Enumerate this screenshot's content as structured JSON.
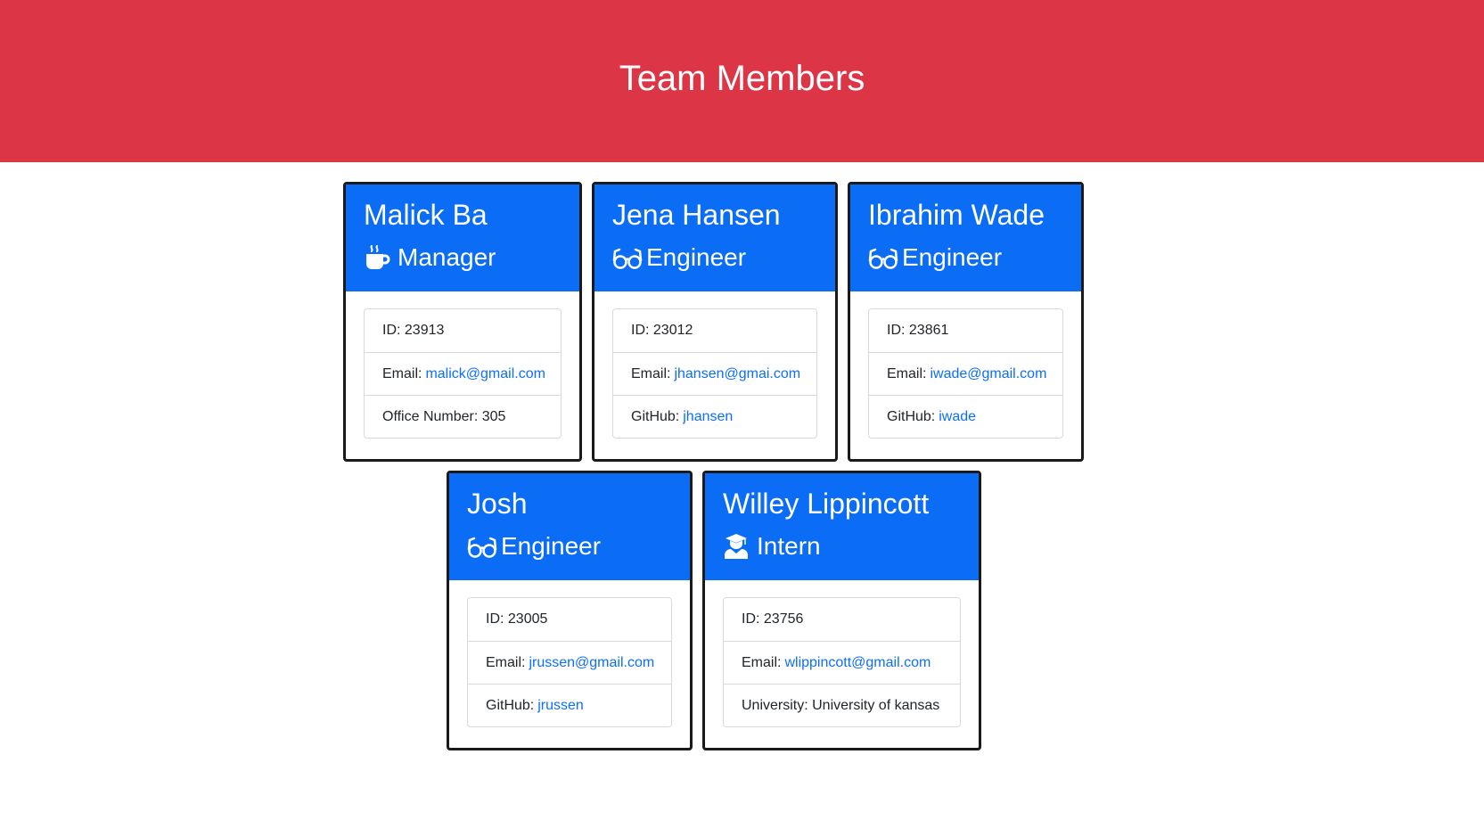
{
  "header": {
    "title": "Team Members",
    "color": "#dc3545"
  },
  "accent_color": "#0b6df6",
  "link_color": "#0d6efd",
  "members": [
    {
      "name": "Malick Ba",
      "role": "Manager",
      "icon": "mug-hot-icon",
      "id_label": "ID: 23913",
      "email_label": "Email:",
      "email": "malick@gmail.com",
      "extra_label": "Office Number: 305",
      "extra_link": ""
    },
    {
      "name": "Jena Hansen",
      "role": "Engineer",
      "icon": "glasses-icon",
      "id_label": "ID: 23012",
      "email_label": "Email:",
      "email": "jhansen@gmai.com",
      "extra_label": "GitHub:",
      "extra_link": "jhansen"
    },
    {
      "name": "Ibrahim Wade",
      "role": "Engineer",
      "icon": "glasses-icon",
      "id_label": "ID: 23861",
      "email_label": "Email:",
      "email": "iwade@gmail.com",
      "extra_label": "GitHub:",
      "extra_link": "iwade"
    },
    {
      "name": "Josh",
      "role": "Engineer",
      "icon": "glasses-icon",
      "id_label": "ID: 23005",
      "email_label": "Email:",
      "email": "jrussen@gmail.com",
      "extra_label": "GitHub:",
      "extra_link": "jrussen"
    },
    {
      "name": "Willey Lippincott",
      "role": "Intern",
      "icon": "user-graduate-icon",
      "id_label": "ID: 23756",
      "email_label": "Email:",
      "email": "wlippincott@gmail.com",
      "extra_label": "University: University of kansas",
      "extra_link": ""
    }
  ]
}
